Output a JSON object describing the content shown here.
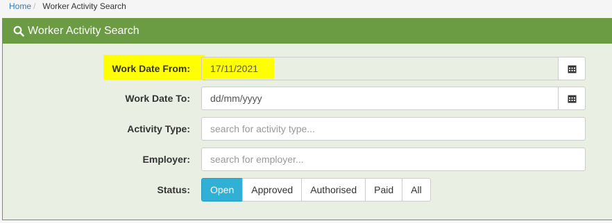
{
  "breadcrumb": {
    "home": "Home",
    "separator": "/",
    "current": "Worker Activity Search"
  },
  "panel": {
    "title": "Worker Activity Search",
    "icon": "search-icon"
  },
  "form": {
    "work_date_from": {
      "label": "Work Date From:",
      "value": "17/11/2021",
      "icon": "calendar-icon"
    },
    "work_date_to": {
      "label": "Work Date To:",
      "placeholder": "dd/mm/yyyy",
      "icon": "calendar-icon"
    },
    "activity_type": {
      "label": "Activity Type:",
      "placeholder": "search for activity type..."
    },
    "employer": {
      "label": "Employer:",
      "placeholder": "search for employer..."
    },
    "status": {
      "label": "Status:",
      "options": [
        "Open",
        "Approved",
        "Authorised",
        "Paid",
        "All"
      ],
      "selected": "Open"
    }
  },
  "colors": {
    "panel_header": "#6b9b43",
    "panel_body": "#e9f0e3",
    "active_button": "#31b0d5",
    "highlight": "#ffff00",
    "link": "#337ab7"
  }
}
